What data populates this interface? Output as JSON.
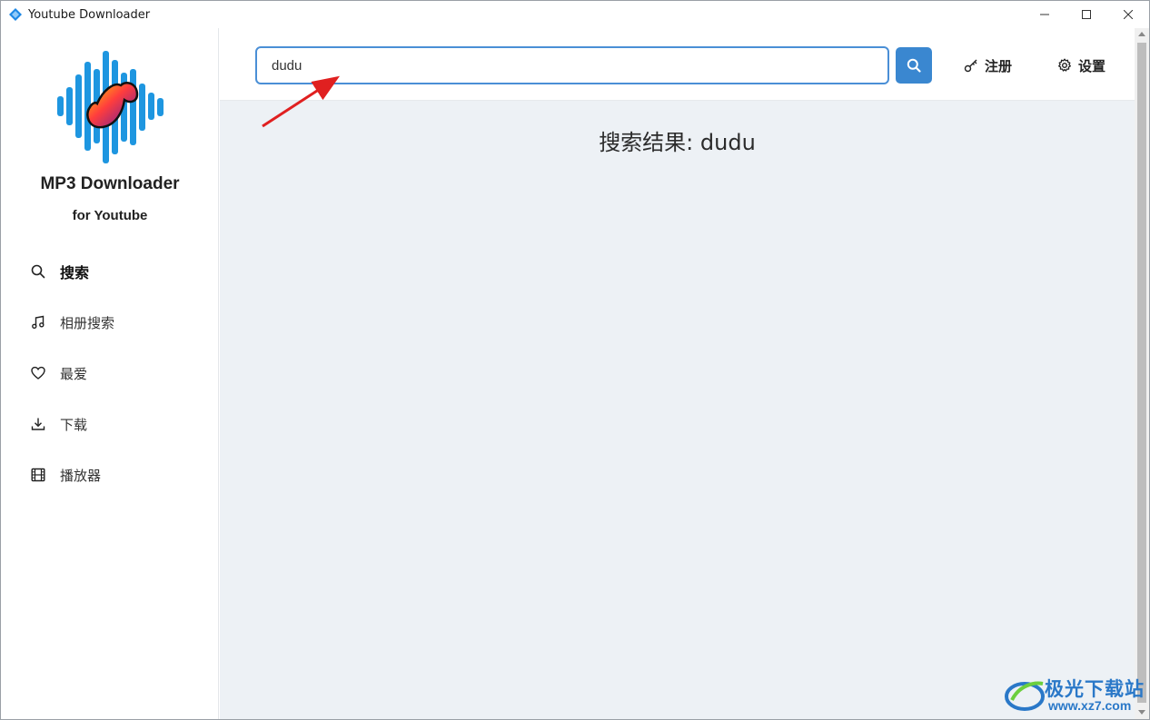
{
  "window": {
    "title": "Youtube Downloader"
  },
  "brand": {
    "title": "MP3 Downloader",
    "subtitle": "for Youtube"
  },
  "sidebar": {
    "items": [
      {
        "label": "搜索",
        "icon": "search-icon",
        "active": true
      },
      {
        "label": "相册搜索",
        "icon": "music-note-icon",
        "active": false
      },
      {
        "label": "最爱",
        "icon": "heart-icon",
        "active": false
      },
      {
        "label": "下载",
        "icon": "download-icon",
        "active": false
      },
      {
        "label": "播放器",
        "icon": "film-icon",
        "active": false
      }
    ]
  },
  "header": {
    "search_value": "dudu",
    "register_label": "注册",
    "settings_label": "设置"
  },
  "main": {
    "results_title": "搜索结果: dudu"
  },
  "watermark": {
    "name": "极光下载站",
    "url": "www.xz7.com"
  },
  "colors": {
    "accent": "#3a87d0",
    "main_bg": "#edf1f5",
    "annotation_arrow": "#e02020"
  }
}
